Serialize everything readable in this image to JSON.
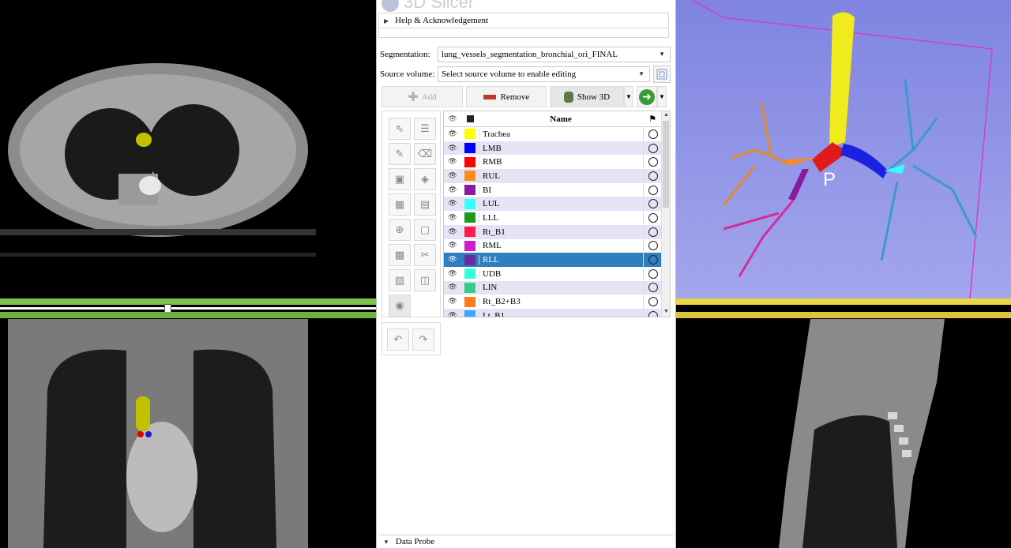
{
  "app": {
    "title": "3D Slicer"
  },
  "help_section": {
    "label": "Help & Acknowledgement"
  },
  "segmentation": {
    "label": "Segmentation:",
    "value": "lung_vessels_segmentation_bronchial_ori_FINAL"
  },
  "source_volume": {
    "label": "Source volume:",
    "value": "Select source volume to enable editing"
  },
  "toolbar": {
    "add_label": "Add",
    "remove_label": "Remove",
    "show3d_label": "Show 3D"
  },
  "table": {
    "header_name": "Name",
    "segments": [
      {
        "name": "Trachea",
        "color": "#ffff00"
      },
      {
        "name": "LMB",
        "color": "#0000ff"
      },
      {
        "name": "RMB",
        "color": "#ff0000"
      },
      {
        "name": "RUL",
        "color": "#ff8c1a"
      },
      {
        "name": "BI",
        "color": "#8a1aa0"
      },
      {
        "name": "LUL",
        "color": "#33ffff"
      },
      {
        "name": "LLL",
        "color": "#1a9a1a"
      },
      {
        "name": "Rt_B1",
        "color": "#ff1a4a"
      },
      {
        "name": "RML",
        "color": "#d01ad0"
      },
      {
        "name": "RLL",
        "color": "#6a2aa0"
      },
      {
        "name": "UDB",
        "color": "#33ffdd"
      },
      {
        "name": "LIN",
        "color": "#33cc88"
      },
      {
        "name": "Rt_B2+B3",
        "color": "#ff7a1a"
      },
      {
        "name": "Lt_B1",
        "color": "#33aaff"
      }
    ],
    "selected_segment": "RLL"
  },
  "data_probe": {
    "label": "Data Probe"
  },
  "threed_view": {
    "orientation_label": "P"
  }
}
